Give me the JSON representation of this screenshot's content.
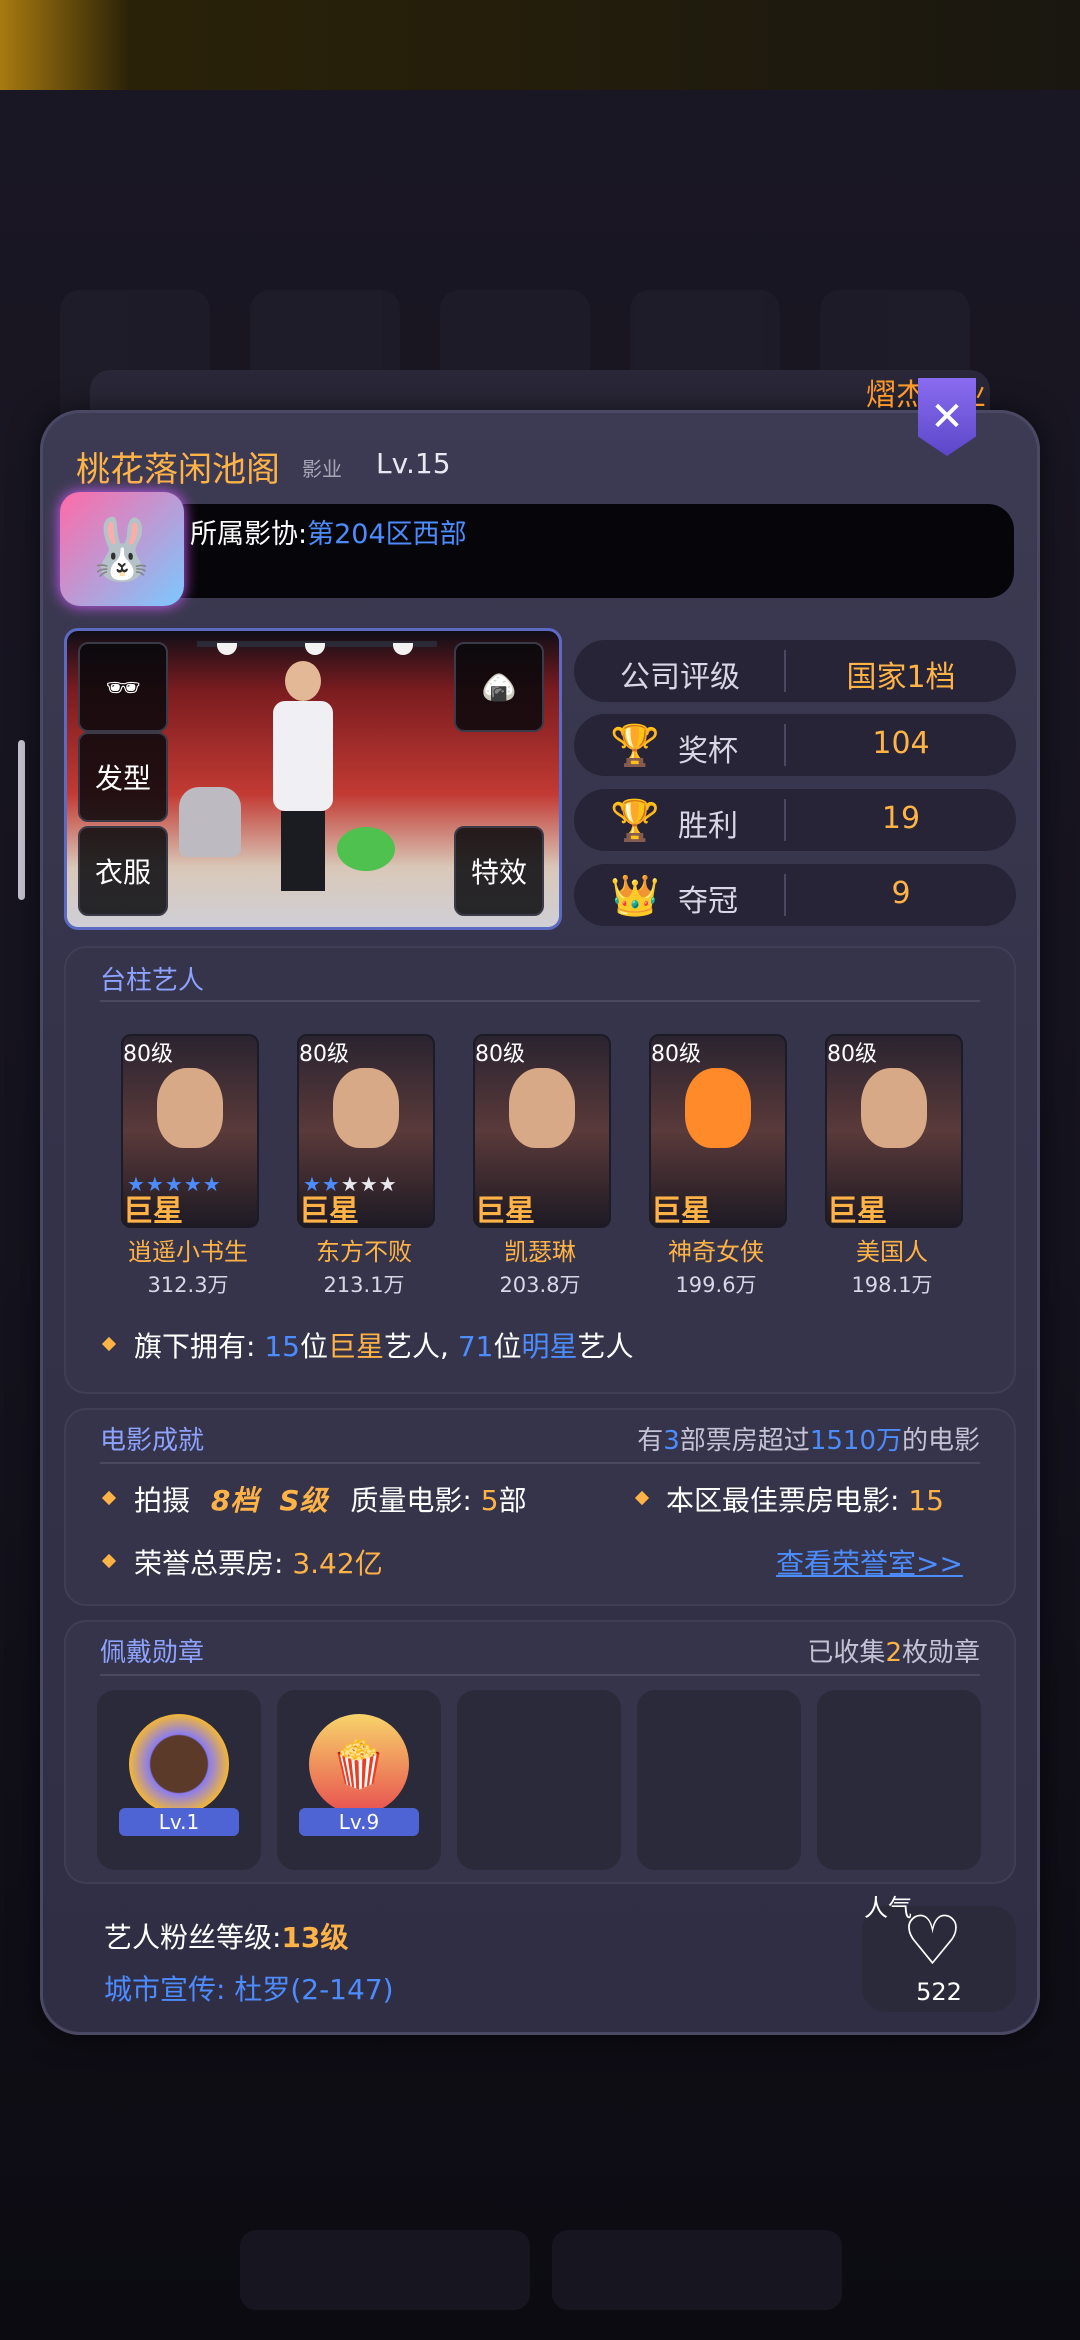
{
  "company": {
    "name": "桃花落闲池阁",
    "type": "影业",
    "level": "Lv.15",
    "association_label": "所属影协:",
    "association_value": "第204区西部",
    "corner_label": "熠杰影业"
  },
  "stage": {
    "hair_button": "发型",
    "clothes_button": "衣服",
    "effects_button": "特效"
  },
  "stats": [
    {
      "label": "公司评级",
      "value": "国家1档"
    },
    {
      "label": "奖杯",
      "value": "104",
      "icon": "trophy-icon"
    },
    {
      "label": "胜利",
      "value": "19",
      "icon": "victory-cup-icon"
    },
    {
      "label": "夺冠",
      "value": "9",
      "icon": "crown-icon"
    }
  ],
  "artists_section": {
    "title": "台柱艺人",
    "artists": [
      {
        "level": "80级",
        "tag": "巨星",
        "name": "逍遥小书生",
        "fans": "312.3万",
        "stars": 5
      },
      {
        "level": "80级",
        "tag": "巨星",
        "name": "东方不败",
        "fans": "213.1万",
        "stars": 2
      },
      {
        "level": "80级",
        "tag": "巨星",
        "name": "凯瑟琳",
        "fans": "203.8万",
        "stars": 0
      },
      {
        "level": "80级",
        "tag": "巨星",
        "name": "神奇女侠",
        "fans": "199.6万",
        "stars": 0
      },
      {
        "level": "80级",
        "tag": "巨星",
        "name": "美国人",
        "fans": "198.1万",
        "stars": 0
      }
    ],
    "summary_prefix": "旗下拥有: ",
    "summary_superstar_count": "15",
    "summary_mid1": "位",
    "summary_superstar_word": "巨星",
    "summary_mid2": "艺人, ",
    "summary_star_count": "71",
    "summary_mid3": "位",
    "summary_star_word": "明星",
    "summary_suffix": "艺人"
  },
  "movies_section": {
    "title": "电影成就",
    "right_prefix": "有",
    "right_count": "3",
    "right_mid": "部票房超过",
    "right_amount": "1510万",
    "right_suffix": "的电影",
    "shoot_label": "拍摄",
    "shoot_grade": "8档",
    "shoot_rank": "S级",
    "quality_label": "质量电影: ",
    "quality_count": "5",
    "quality_unit": "部",
    "best_label": "本区最佳票房电影: ",
    "best_value": "15",
    "total_label": "荣誉总票房: ",
    "total_value": "3.42亿",
    "honor_link": "查看荣誉室>>"
  },
  "medals_section": {
    "title": "佩戴勋章",
    "right_prefix": "已收集",
    "right_count": "2",
    "right_suffix": "枚勋章",
    "medals": [
      {
        "level": "Lv.1",
        "icon": "portrait-medal-icon"
      },
      {
        "level": "Lv.9",
        "icon": "popcorn-medal-icon"
      }
    ]
  },
  "footer": {
    "fan_level_label": "艺人粉丝等级:",
    "fan_level_value": "13级",
    "city_label": "城市宣传: ",
    "city_value": "杜罗(2-147)",
    "popularity_label": "人气",
    "popularity_value": "522"
  },
  "colors": {
    "accent_orange": "#ffb347",
    "accent_blue": "#4c8cff",
    "panel_bg": "#35334a"
  }
}
